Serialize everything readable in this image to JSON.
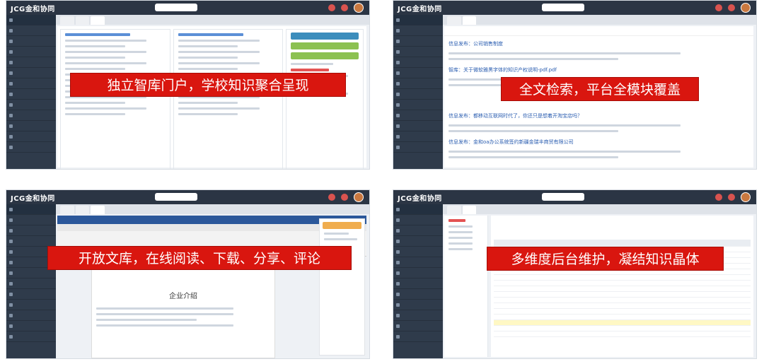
{
  "panels": [
    {
      "key": "knowledge-portal",
      "app_logo": "JCG金和协同",
      "banner_text": "独立智库门户，学校知识聚合呈现"
    },
    {
      "key": "fulltext-search",
      "app_logo": "JCG金和协同",
      "banner_text": "全文检索，平台全模块覆盖",
      "result_titles": [
        "信息发布：公司销售制度",
        "智库：关于微软雅黑字体的知识产权说明-pdf.pdf",
        "信息发布：都移动互联网时代了，你还只是想着开淘宝店吗？",
        "信息发布：金和oa办公系统签约新疆金瑞丰商贸有限公司"
      ]
    },
    {
      "key": "open-library",
      "app_logo": "JCG金和协同",
      "banner_text": "开放文库，在线阅读、下载、分享、评论",
      "doc_heading": "企业介绍"
    },
    {
      "key": "backend-maintenance",
      "app_logo": "JCG金和协同",
      "banner_text": "多维度后台维护，凝结知识晶体"
    }
  ],
  "colors": {
    "banner_red": "#d9160f",
    "topbar_dark": "#2b3544",
    "sidebar_dark": "#2f3b4b"
  }
}
